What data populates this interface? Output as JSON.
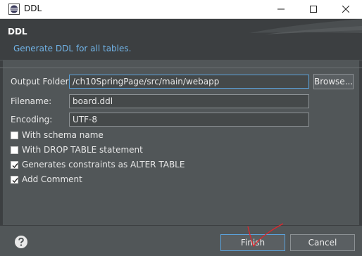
{
  "window": {
    "title": "DDL",
    "icon": "eclipse-icon",
    "controls": [
      "minimize-icon",
      "maximize-icon",
      "close-icon"
    ]
  },
  "header": {
    "title": "DDL",
    "message": "Generate DDL for all tables."
  },
  "form": {
    "output_folder": {
      "label": "Output Folder:",
      "value": "/ch10SpringPage/src/main/webapp"
    },
    "browse_label": "Browse...",
    "filename": {
      "label": "Filename:",
      "value": "board.ddl"
    },
    "encoding": {
      "label": "Encoding:",
      "value": "UTF-8"
    }
  },
  "options": [
    {
      "label": "With schema name",
      "checked": false
    },
    {
      "label": "With DROP TABLE statement",
      "checked": false
    },
    {
      "label": "Generates constraints as ALTER TABLE",
      "checked": true
    },
    {
      "label": "Add Comment",
      "checked": true
    }
  ],
  "footer": {
    "help_icon": "help-icon",
    "finish_label": "Finish",
    "cancel_label": "Cancel"
  },
  "colors": {
    "header_bg": "#3c3f41",
    "body_bg": "#515658",
    "message_text": "#71b3e6",
    "focus_border": "#5ba2db",
    "annotation_mark": "#e0262c"
  }
}
